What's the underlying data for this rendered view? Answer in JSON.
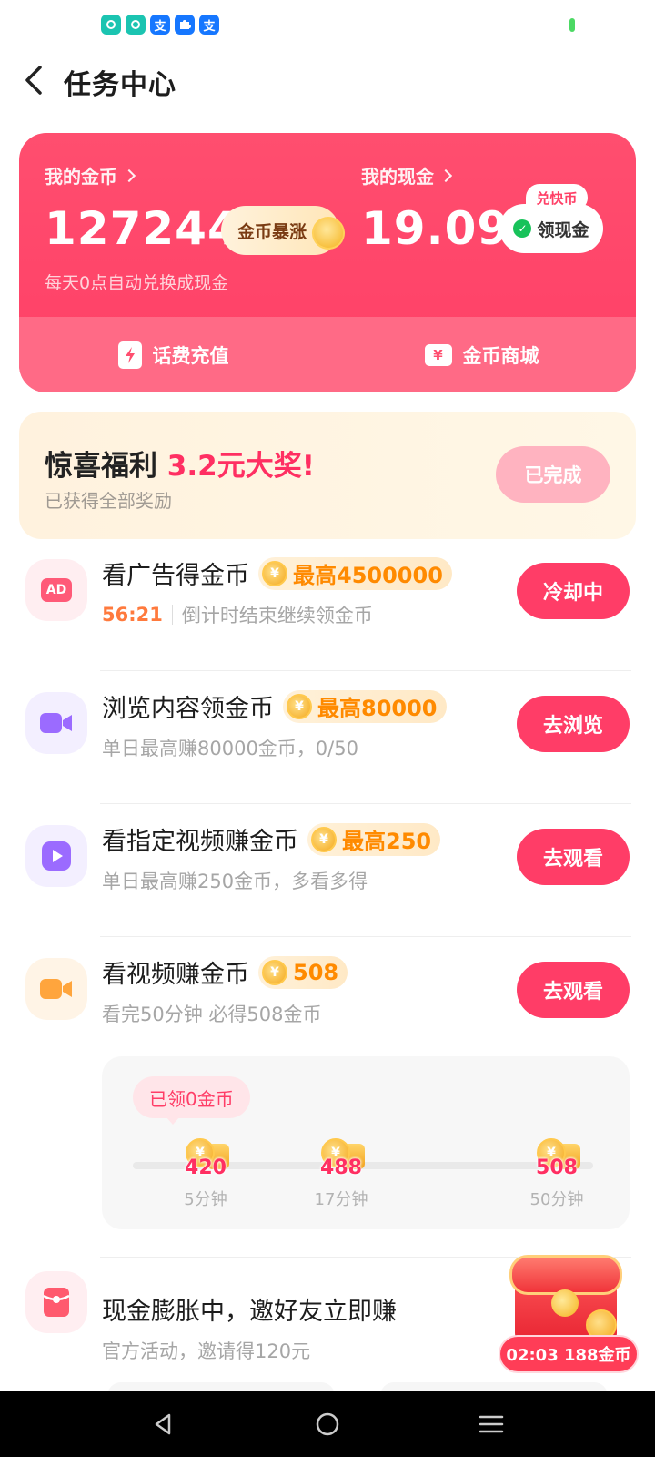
{
  "status_bar": {
    "icons": [
      "chat-icon",
      "chat-icon",
      "alipay-icon",
      "puzzle-icon",
      "alipay-icon"
    ],
    "alipay_glyph": "支"
  },
  "header": {
    "title": "任务中心"
  },
  "wallet": {
    "coins_label": "我的金币",
    "coins_value": "127244",
    "surge_label": "金币暴涨",
    "cash_label": "我的现金",
    "cash_value": "19.09",
    "withdraw_label": "领现金",
    "subtitle": "每天0点自动兑换成现金",
    "recharge_label": "话费充值",
    "mall_label": "金币商城",
    "exchange_badge": "兑快币"
  },
  "bonus": {
    "title_prefix": "惊喜福利 ",
    "title_highlight": "3.2元大奖!",
    "subtitle": "已获得全部奖励",
    "button_label": "已完成"
  },
  "tasks": [
    {
      "title": "看广告得金币",
      "reward": "最高4500000",
      "timer": "56:21",
      "subtitle": "倒计时结束继续领金币",
      "button": "冷却中",
      "icon": "ad-icon"
    },
    {
      "title": "浏览内容领金币",
      "reward": "最高80000",
      "subtitle": "单日最高赚80000金币，0/50",
      "button": "去浏览",
      "icon": "video-camera-icon"
    },
    {
      "title": "看指定视频赚金币",
      "reward": "最高250",
      "subtitle": "单日最高赚250金币，多看多得",
      "button": "去观看",
      "icon": "play-icon"
    },
    {
      "title": "看视频赚金币",
      "reward": "508",
      "subtitle": "看完50分钟 必得508金币",
      "button": "去观看",
      "icon": "video-camera-icon"
    }
  ],
  "progress": {
    "claimed_label": "已领0金币",
    "current_fraction": 0,
    "milestones": [
      {
        "value": "420",
        "time": "5分钟"
      },
      {
        "value": "488",
        "time": "17分钟"
      },
      {
        "value": "508",
        "time": "50分钟"
      }
    ]
  },
  "invite": {
    "title": "现金膨胀中，邀好友立即赚",
    "subtitle": "官方活动，邀请得120元",
    "chest_timer": "02:03 188金币"
  },
  "coin_glyph": "¥",
  "colors": {
    "accent": "#ff3d67",
    "wallet_bg": "#ff4e6f",
    "reward_orange": "#ff8a00",
    "timer_orange": "#ff7a3d"
  }
}
